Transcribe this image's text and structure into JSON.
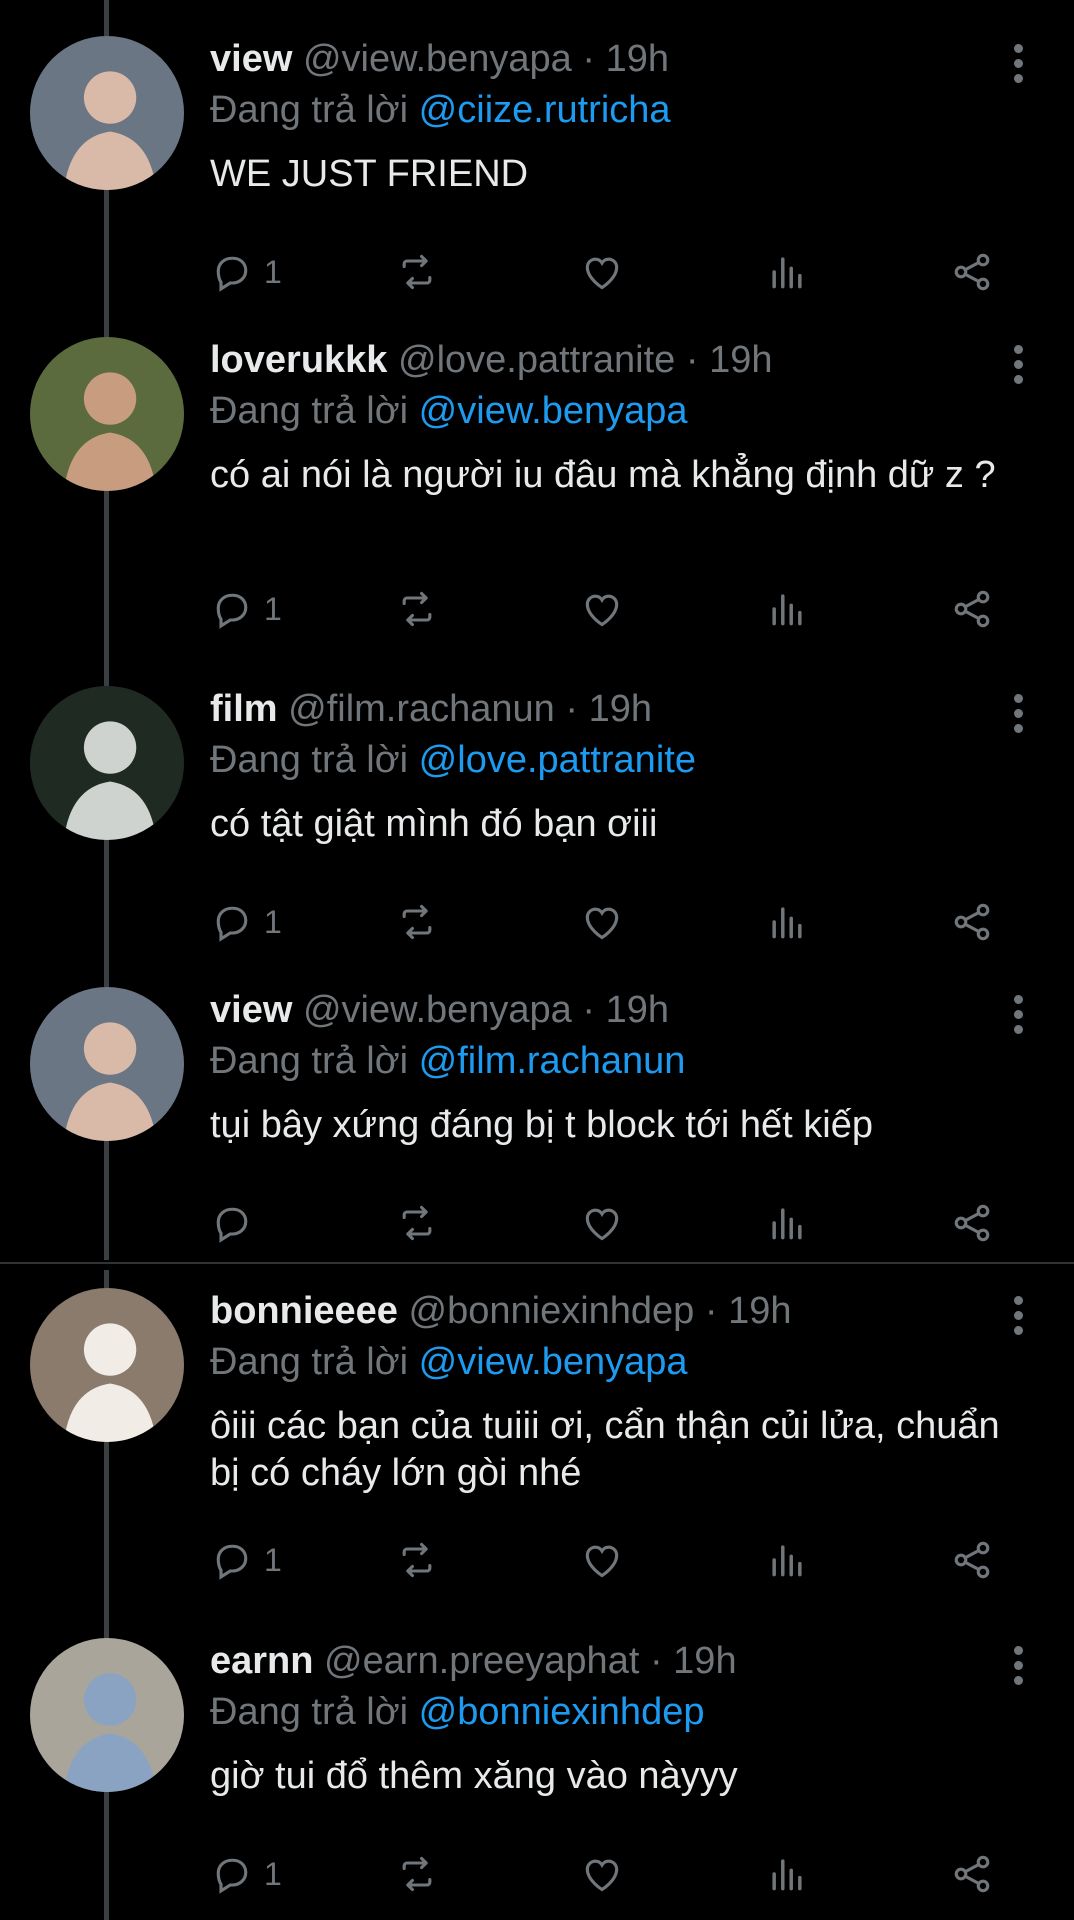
{
  "reply_prefix": "Đang trả lời",
  "tweets": [
    {
      "name": "view",
      "handle": "@view.benyapa",
      "dot": "·",
      "time": "19h",
      "reply_to": "@ciize.rutricha",
      "text": "WE JUST FRIEND",
      "reply_count": "1",
      "avatar_bg": "#6a7684",
      "avatar_accent": "#d9b9a8"
    },
    {
      "name": "loverukkk",
      "handle": "@love.pattranite",
      "dot": "·",
      "time": "19h",
      "reply_to": "@view.benyapa",
      "text": "có ai nói là người iu đâu mà khẳng định dữ z ?",
      "reply_count": "1",
      "avatar_bg": "#5c6b3e",
      "avatar_accent": "#c79c7f"
    },
    {
      "name": "film",
      "handle": "@film.rachanun",
      "dot": "·",
      "time": "19h",
      "reply_to": "@love.pattranite",
      "text": "có tật giật mình đó bạn ơiii",
      "reply_count": "1",
      "avatar_bg": "#1e2a22",
      "avatar_accent": "#cfd3cf"
    },
    {
      "name": "view",
      "handle": "@view.benyapa",
      "dot": "·",
      "time": "19h",
      "reply_to": "@film.rachanun",
      "text": "tụi bây xứng đáng bị t block tới hết kiếp",
      "reply_count": "",
      "avatar_bg": "#6a7684",
      "avatar_accent": "#d9b9a8"
    },
    {
      "name": "bonnieeee",
      "handle": "@bonniexinhdep",
      "dot": "·",
      "time": "19h",
      "reply_to": "@view.benyapa",
      "text": "ôiii các bạn của tuiii ơi, cẩn thận củi lửa, chuẩn bị có cháy lớn gòi nhé",
      "reply_count": "1",
      "avatar_bg": "#8a7b6d",
      "avatar_accent": "#f2ece6"
    },
    {
      "name": "earnn",
      "handle": "@earn.preeyaphat",
      "dot": "·",
      "time": "19h",
      "reply_to": "@bonniexinhdep",
      "text": "giờ tui đổ thêm xăng vào nàyyy",
      "reply_count": "1",
      "avatar_bg": "#a9a59a",
      "avatar_accent": "#8aa3c2"
    }
  ],
  "colors": {
    "background": "#000000",
    "text": "#e7e9ea",
    "muted": "#71767b",
    "mention": "#1d9bf0"
  }
}
